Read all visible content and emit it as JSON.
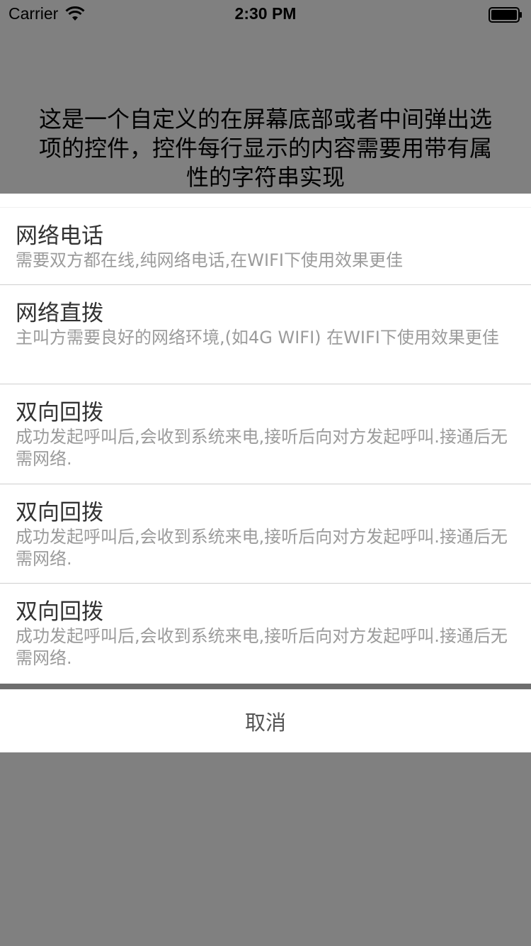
{
  "status_bar": {
    "carrier": "Carrier",
    "time": "2:30 PM",
    "wifi_icon": "wifi-icon",
    "battery_icon": "battery-icon"
  },
  "headline": "这是一个自定义的在屏幕底部或者中间弹出选项的控件，控件每行显示的内容需要用带有属性的字符串实现",
  "options": [
    {
      "title": "网络电话",
      "description": "需要双方都在线,纯网络电话,在WIFI下使用效果更佳"
    },
    {
      "title": "网络直拨",
      "description": "主叫方需要良好的网络环境,(如4G WIFI) 在WIFI下使用效果更佳"
    },
    {
      "title": "双向回拨",
      "description": "成功发起呼叫后,会收到系统来电,接听后向对方发起呼叫.接通后无需网络."
    },
    {
      "title": "双向回拨",
      "description": "成功发起呼叫后,会收到系统来电,接听后向对方发起呼叫.接通后无需网络."
    },
    {
      "title": "双向回拨",
      "description": "成功发起呼叫后,会收到系统来电,接听后向对方发起呼叫.接通后无需网络."
    }
  ],
  "cancel_label": "取消",
  "colors": {
    "overlay": "#808080",
    "sheet": "#ffffff",
    "title_text": "#333333",
    "description_text": "#9b9b9b"
  }
}
